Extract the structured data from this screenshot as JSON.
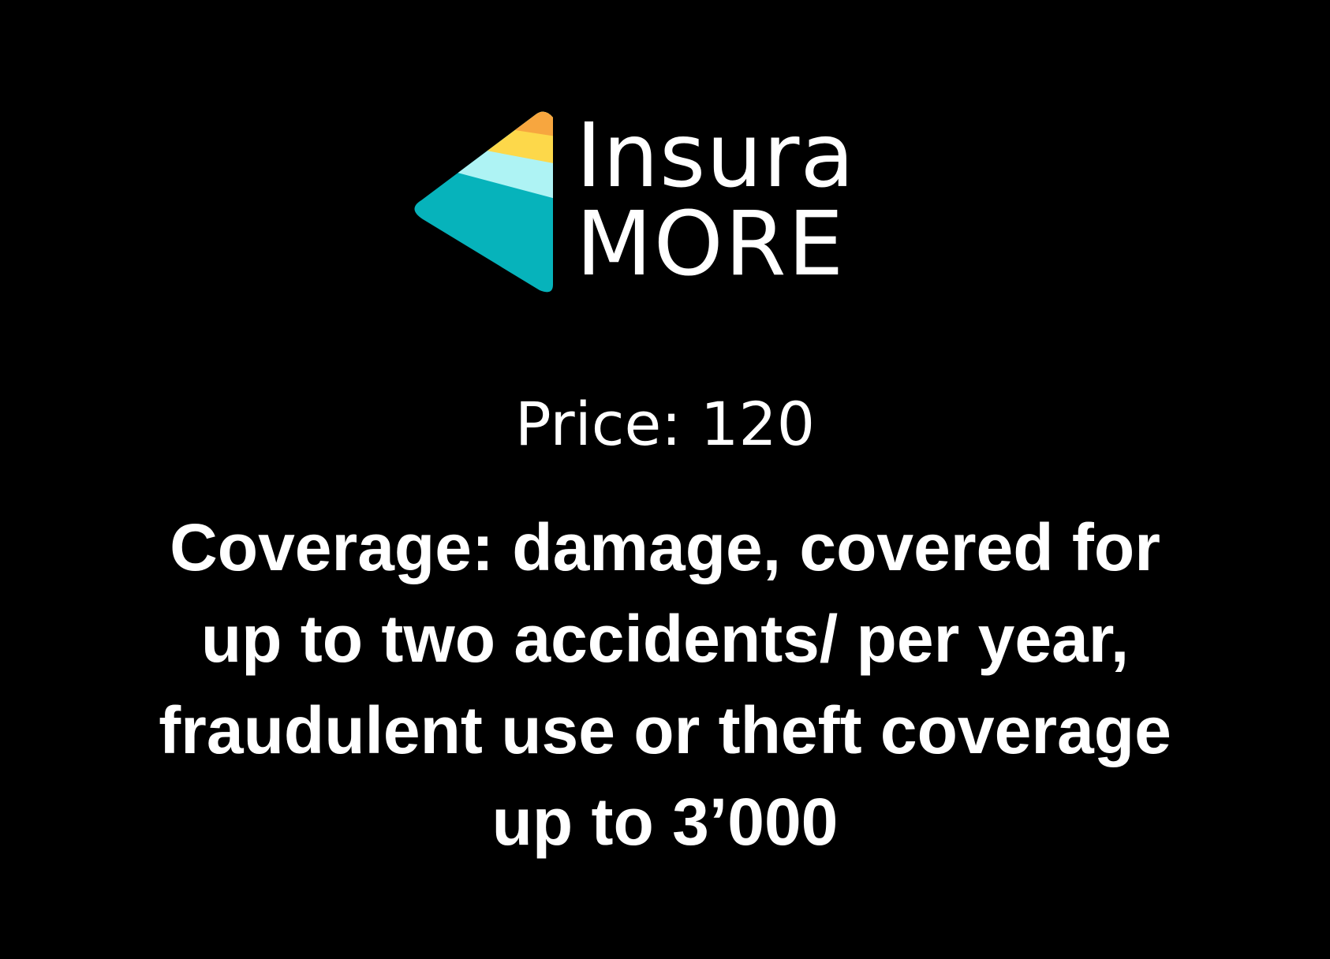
{
  "logo": {
    "wordmark_line_1": "Insura",
    "wordmark_line_2": "MORE",
    "colors": {
      "orange": "#f7a63f",
      "yellow": "#fdd84a",
      "light_cyan": "#aef3f4",
      "teal": "#06b3bb",
      "text": "#ffffff"
    }
  },
  "offer": {
    "price_text": "Price: 120",
    "coverage_lines": [
      "Coverage: damage, covered for",
      "up to two accidents/ per year,",
      "fraudulent use or theft coverage",
      "up to 3’000"
    ]
  },
  "colors": {
    "background": "#000000",
    "text": "#ffffff"
  }
}
